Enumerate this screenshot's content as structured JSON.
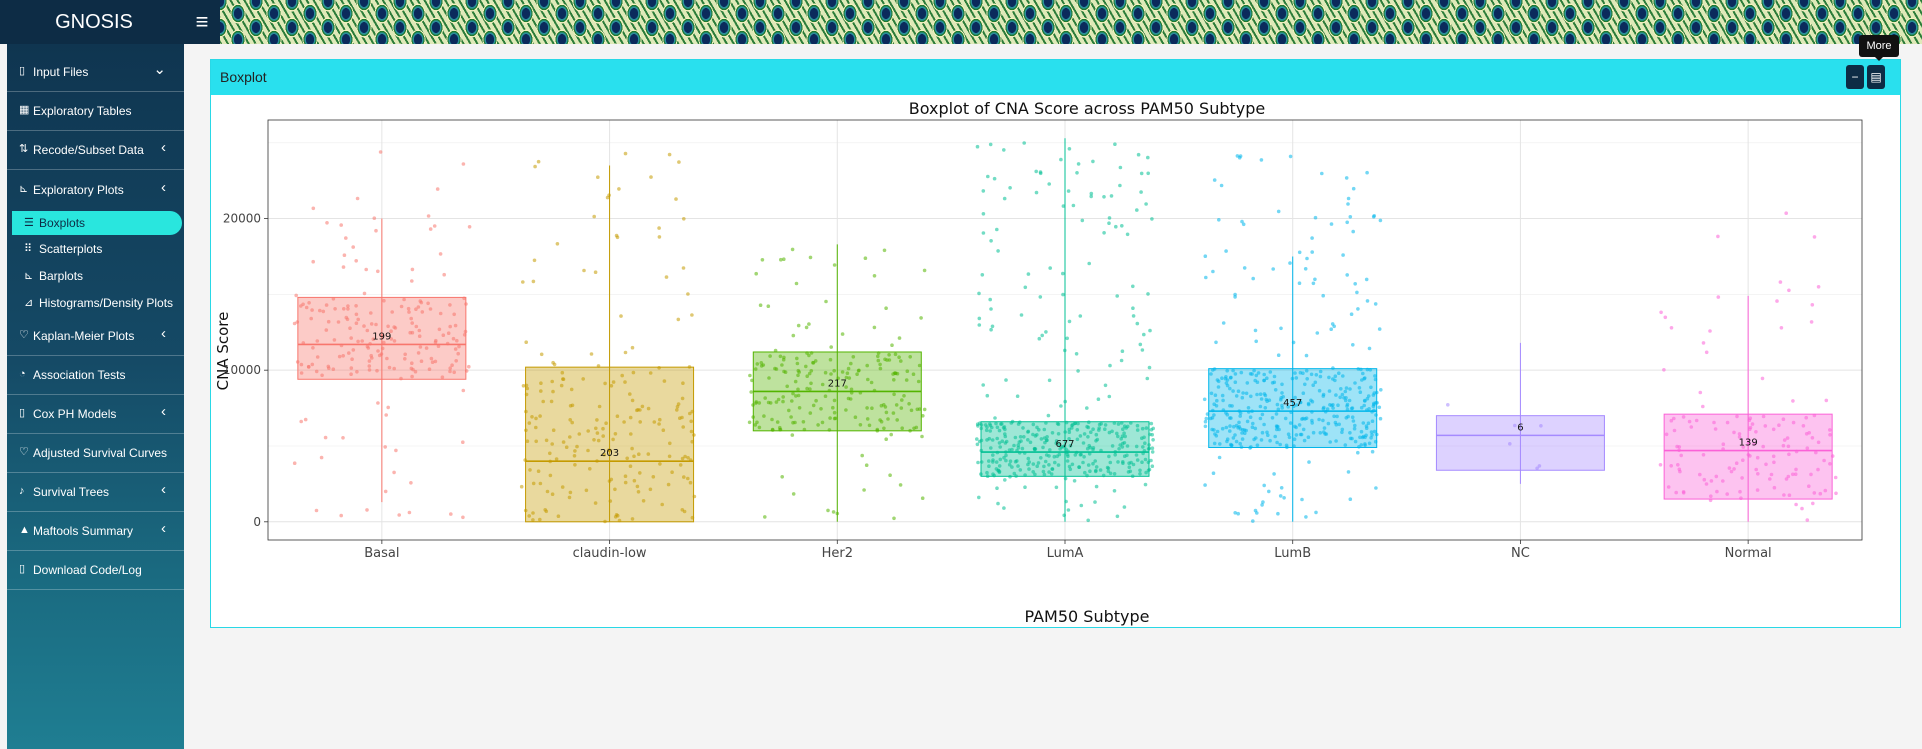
{
  "app": {
    "title": "GNOSIS"
  },
  "sidebar": {
    "items": [
      {
        "label": "Input Files",
        "icon": "file-icon",
        "chevron": "down"
      },
      {
        "label": "Exploratory Tables",
        "icon": "table-icon",
        "chevron": ""
      },
      {
        "label": "Recode/Subset Data",
        "icon": "sort-icon",
        "chevron": "left"
      },
      {
        "label": "Exploratory Plots",
        "icon": "chart-icon",
        "chevron": "left"
      },
      {
        "label": "Kaplan-Meier Plots",
        "icon": "heartbeat-icon",
        "chevron": "left"
      },
      {
        "label": "Association Tests",
        "icon": "gauge-icon",
        "chevron": ""
      },
      {
        "label": "Cox PH Models",
        "icon": "file-icon",
        "chevron": "left"
      },
      {
        "label": "Adjusted Survival Curves",
        "icon": "heartbeat-icon",
        "chevron": ""
      },
      {
        "label": "Survival Trees",
        "icon": "bell-icon",
        "chevron": "left"
      },
      {
        "label": "Maftools Summary",
        "icon": "warning-icon",
        "chevron": "left"
      },
      {
        "label": "Download Code/Log",
        "icon": "file-icon",
        "chevron": ""
      }
    ],
    "subitems": [
      {
        "label": "Boxplots",
        "icon": "list-icon",
        "active": true
      },
      {
        "label": "Scatterplots",
        "icon": "grid-icon",
        "active": false
      },
      {
        "label": "Barplots",
        "icon": "bar-chart-icon",
        "active": false
      },
      {
        "label": "Histograms/Density Plots",
        "icon": "area-chart-icon",
        "active": false
      }
    ]
  },
  "panel": {
    "title": "Boxplot",
    "minimize_label": "−",
    "more_label": "▤",
    "tooltip": "More"
  },
  "chart_data": {
    "type": "boxplot",
    "title": "Boxplot of CNA Score across PAM50 Subtype",
    "xlabel": "PAM50 Subtype",
    "ylabel": "CNA Score",
    "ylim": [
      -1200,
      26500
    ],
    "yticks": [
      0,
      10000,
      20000
    ],
    "ytick_labels": [
      "0",
      "10000",
      "20000"
    ],
    "grid": true,
    "groups": [
      {
        "name": "Basal",
        "n": "199",
        "color": "#f8766d",
        "min": 1300,
        "q1": 9400,
        "median": 11700,
        "q3": 14800,
        "max": 20000,
        "jitter_lo": 0,
        "jitter_hi": 24500
      },
      {
        "name": "claudin-low",
        "n": "203",
        "color": "#c49a00",
        "min": 0,
        "q1": 0,
        "median": 4000,
        "q3": 10200,
        "max": 23500,
        "jitter_lo": 0,
        "jitter_hi": 25300
      },
      {
        "name": "Her2",
        "n": "217",
        "color": "#53b400",
        "min": 0,
        "q1": 6000,
        "median": 8600,
        "q3": 11200,
        "max": 18300,
        "jitter_lo": 0,
        "jitter_hi": 18300
      },
      {
        "name": "LumA",
        "n": "677",
        "color": "#00c094",
        "min": 0,
        "q1": 3000,
        "median": 4600,
        "q3": 6600,
        "max": 25300,
        "jitter_lo": 0,
        "jitter_hi": 25300
      },
      {
        "name": "LumB",
        "n": "457",
        "color": "#00b6eb",
        "min": 0,
        "q1": 4900,
        "median": 7300,
        "q3": 10100,
        "max": 17500,
        "jitter_lo": 0,
        "jitter_hi": 24200
      },
      {
        "name": "NC",
        "n": "6",
        "color": "#a58aff",
        "min": 2500,
        "q1": 3400,
        "median": 5700,
        "q3": 7000,
        "max": 11800,
        "jitter_lo": 2500,
        "jitter_hi": 11800
      },
      {
        "name": "Normal",
        "n": "139",
        "color": "#fb61d7",
        "min": 0,
        "q1": 1500,
        "median": 4700,
        "q3": 7100,
        "max": 14900,
        "jitter_lo": 0,
        "jitter_hi": 21300
      }
    ]
  }
}
